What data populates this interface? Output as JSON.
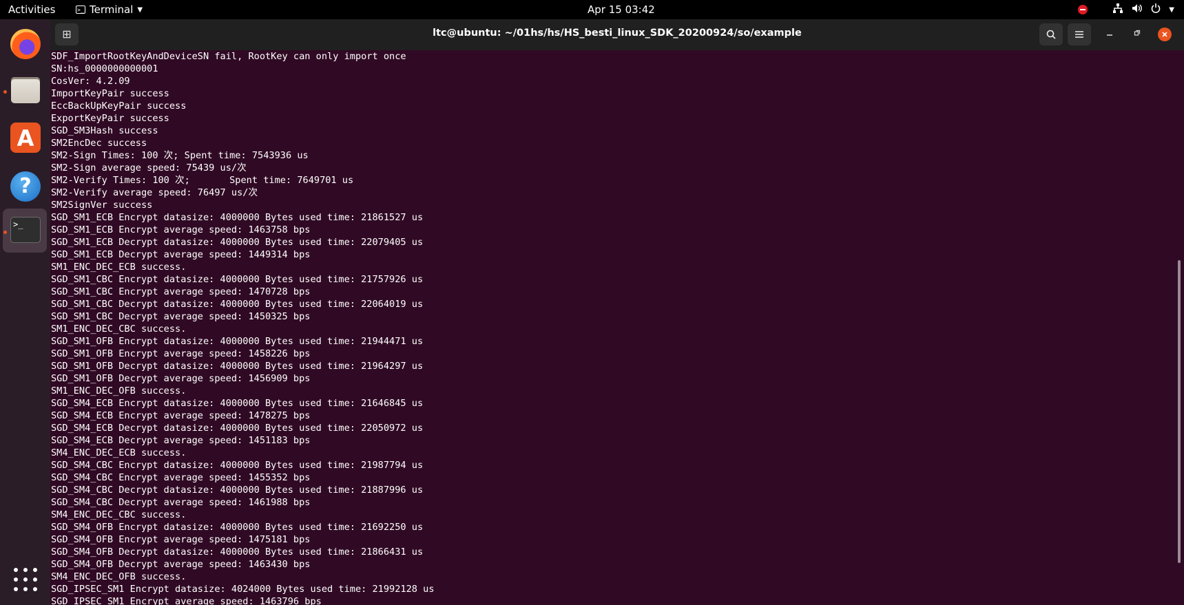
{
  "topbar": {
    "activities": "Activities",
    "app_name": "Terminal",
    "clock": "Apr 15  03:42"
  },
  "window": {
    "title": "ltc@ubuntu: ~/01hs/hs/HS_besti_linux_SDK_20200924/so/example"
  },
  "terminal": {
    "lines": [
      "SDF_ImportRootKeyAndDeviceSN fail, RootKey can only import once",
      "SN:hs_0000000000001",
      "CosVer: 4.2.09",
      "ImportKeyPair success",
      "EccBackUpKeyPair success",
      "ExportKeyPair success",
      "SGD_SM3Hash success",
      "SM2EncDec success",
      "SM2-Sign Times: 100 次; Spent time: 7543936 us",
      "SM2-Sign average speed: 75439 us/次",
      "SM2-Verify Times: 100 次;       Spent time: 7649701 us",
      "SM2-Verify average speed: 76497 us/次",
      "SM2SignVer success",
      "SGD_SM1_ECB Encrypt datasize: 4000000 Bytes used time: 21861527 us",
      "SGD_SM1_ECB Encrypt average speed: 1463758 bps",
      "SGD_SM1_ECB Decrypt datasize: 4000000 Bytes used time: 22079405 us",
      "SGD_SM1_ECB Decrypt average speed: 1449314 bps",
      "SM1_ENC_DEC_ECB success.",
      "SGD_SM1_CBC Encrypt datasize: 4000000 Bytes used time: 21757926 us",
      "SGD_SM1_CBC Encrypt average speed: 1470728 bps",
      "SGD_SM1_CBC Decrypt datasize: 4000000 Bytes used time: 22064019 us",
      "SGD_SM1_CBC Decrypt average speed: 1450325 bps",
      "SM1_ENC_DEC_CBC success.",
      "SGD_SM1_OFB Encrypt datasize: 4000000 Bytes used time: 21944471 us",
      "SGD_SM1_OFB Encrypt average speed: 1458226 bps",
      "SGD_SM1_OFB Decrypt datasize: 4000000 Bytes used time: 21964297 us",
      "SGD_SM1_OFB Decrypt average speed: 1456909 bps",
      "SM1_ENC_DEC_OFB success.",
      "SGD_SM4_ECB Encrypt datasize: 4000000 Bytes used time: 21646845 us",
      "SGD_SM4_ECB Encrypt average speed: 1478275 bps",
      "SGD_SM4_ECB Decrypt datasize: 4000000 Bytes used time: 22050972 us",
      "SGD_SM4_ECB Decrypt average speed: 1451183 bps",
      "SM4_ENC_DEC_ECB success.",
      "SGD_SM4_CBC Encrypt datasize: 4000000 Bytes used time: 21987794 us",
      "SGD_SM4_CBC Encrypt average speed: 1455352 bps",
      "SGD_SM4_CBC Decrypt datasize: 4000000 Bytes used time: 21887996 us",
      "SGD_SM4_CBC Decrypt average speed: 1461988 bps",
      "SM4_ENC_DEC_CBC success.",
      "SGD_SM4_OFB Encrypt datasize: 4000000 Bytes used time: 21692250 us",
      "SGD_SM4_OFB Encrypt average speed: 1475181 bps",
      "SGD_SM4_OFB Decrypt datasize: 4000000 Bytes used time: 21866431 us",
      "SGD_SM4_OFB Decrypt average speed: 1463430 bps",
      "SM4_ENC_DEC_OFB success.",
      "SGD_IPSEC_SM1 Encrypt datasize: 4024000 Bytes used time: 21992128 us",
      "SGD_IPSEC_SM1 Encrypt average speed: 1463796 bps"
    ]
  },
  "icons": {
    "dock": [
      "firefox-icon",
      "files-icon",
      "software-icon",
      "help-icon",
      "terminal-icon",
      "show-apps-icon"
    ],
    "tray": [
      "do-not-disturb-icon",
      "network-icon",
      "volume-icon",
      "power-icon"
    ]
  },
  "colors": {
    "terminal_bg": "#300a24",
    "headerbar_bg": "#202020",
    "accent": "#e95420"
  }
}
